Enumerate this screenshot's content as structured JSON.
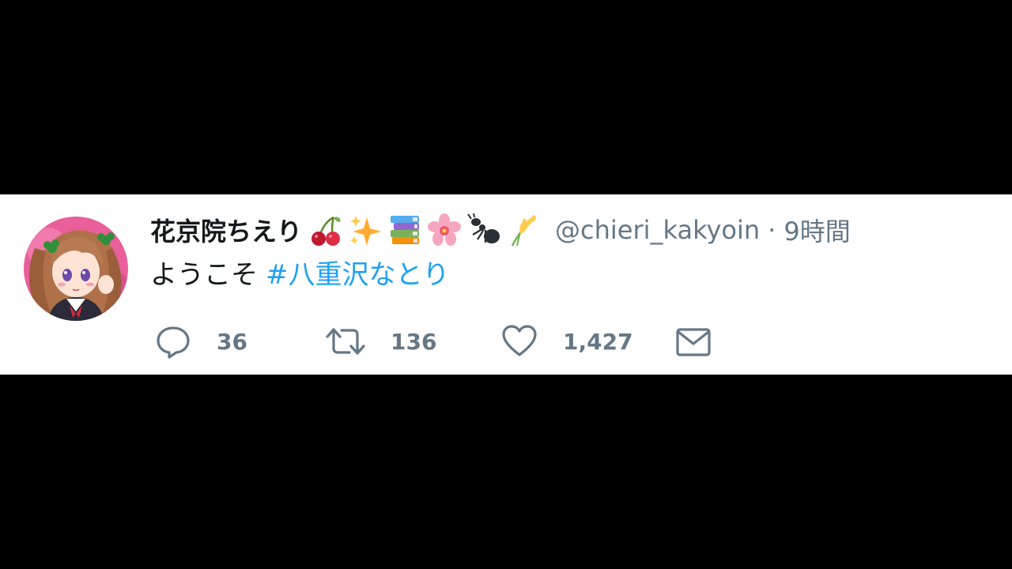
{
  "tweet": {
    "display_name": "花京院ちえり",
    "name_emoji_icons": [
      "cherries-icon",
      "sparkles-icon",
      "books-icon",
      "cherry-blossom-icon",
      "ant-icon",
      "rice-plant-icon"
    ],
    "handle": "@chieri_kakyoin",
    "separator": "·",
    "timestamp": "9時間",
    "text": "ようこそ",
    "hashtag": "#八重沢なとり",
    "reply_count": "36",
    "retweet_count": "136",
    "like_count": "1,427"
  },
  "colors": {
    "background": "#000000",
    "card": "#ffffff",
    "text": "#14171a",
    "secondary": "#657786",
    "link": "#1da1f2"
  }
}
